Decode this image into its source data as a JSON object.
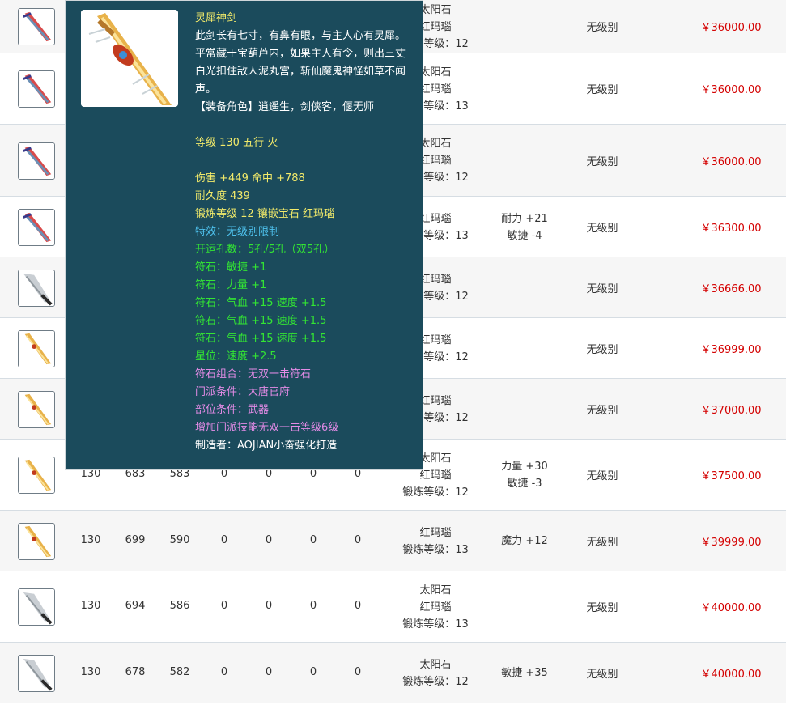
{
  "rows": [
    {
      "level": "",
      "a": "",
      "b": "",
      "z1": "",
      "z2": "",
      "z3": "",
      "z4": "",
      "gem_lines": [
        "太阳石",
        "红玛瑙",
        "锻炼等级：12"
      ],
      "attr_lines": [],
      "category": "无级别",
      "price": "￥36000.00",
      "icon": "red-sword-icon"
    },
    {
      "level": "",
      "a": "",
      "b": "",
      "z1": "",
      "z2": "",
      "z3": "",
      "z4": "",
      "gem_lines": [
        "太阳石",
        "红玛瑙",
        "锻炼等级：13"
      ],
      "attr_lines": [],
      "category": "无级别",
      "price": "￥36000.00",
      "icon": "red-sword-icon"
    },
    {
      "level": "",
      "a": "",
      "b": "",
      "z1": "",
      "z2": "",
      "z3": "",
      "z4": "",
      "gem_lines": [
        "太阳石",
        "红玛瑙",
        "锻炼等级：12"
      ],
      "attr_lines": [],
      "category": "无级别",
      "price": "￥36000.00",
      "icon": "red-sword-icon"
    },
    {
      "level": "",
      "a": "",
      "b": "",
      "z1": "",
      "z2": "",
      "z3": "",
      "z4": "",
      "gem_lines": [
        "红玛瑙",
        "锻炼等级：13"
      ],
      "attr_lines": [
        "耐力 +21",
        "敏捷 -4"
      ],
      "category": "无级别",
      "price": "￥36300.00",
      "icon": "red-sword-icon"
    },
    {
      "level": "",
      "a": "",
      "b": "",
      "z1": "",
      "z2": "",
      "z3": "",
      "z4": "",
      "gem_lines": [
        "红玛瑙",
        "锻炼等级：12"
      ],
      "attr_lines": [],
      "category": "无级别",
      "price": "￥36666.00",
      "icon": "silver-blade-icon"
    },
    {
      "level": "",
      "a": "",
      "b": "",
      "z1": "",
      "z2": "",
      "z3": "",
      "z4": "",
      "gem_lines": [
        "红玛瑙",
        "锻炼等级：12"
      ],
      "attr_lines": [],
      "category": "无级别",
      "price": "￥36999.00",
      "icon": "gold-sword-icon"
    },
    {
      "level": "",
      "a": "",
      "b": "",
      "z1": "",
      "z2": "",
      "z3": "",
      "z4": "",
      "gem_lines": [
        "红玛瑙",
        "锻炼等级：12"
      ],
      "attr_lines": [],
      "category": "无级别",
      "price": "￥37000.00",
      "icon": "gold-sword-icon"
    },
    {
      "level": "130",
      "a": "683",
      "b": "583",
      "z1": "0",
      "z2": "0",
      "z3": "0",
      "z4": "0",
      "gem_lines": [
        "太阳石",
        "红玛瑙",
        "锻炼等级：12"
      ],
      "attr_lines": [
        "力量 +30",
        "敏捷 -3"
      ],
      "category": "无级别",
      "price": "￥37500.00",
      "icon": "gold-sword-icon"
    },
    {
      "level": "130",
      "a": "699",
      "b": "590",
      "z1": "0",
      "z2": "0",
      "z3": "0",
      "z4": "0",
      "gem_lines": [
        "红玛瑙",
        "锻炼等级：13"
      ],
      "attr_lines": [
        "魔力 +12"
      ],
      "category": "无级别",
      "price": "￥39999.00",
      "icon": "gold-sword-icon"
    },
    {
      "level": "130",
      "a": "694",
      "b": "586",
      "z1": "0",
      "z2": "0",
      "z3": "0",
      "z4": "0",
      "gem_lines": [
        "太阳石",
        "红玛瑙",
        "锻炼等级：13"
      ],
      "attr_lines": [],
      "category": "无级别",
      "price": "￥40000.00",
      "icon": "silver-blade-icon"
    },
    {
      "level": "130",
      "a": "678",
      "b": "582",
      "z1": "0",
      "z2": "0",
      "z3": "0",
      "z4": "0",
      "gem_lines": [
        "太阳石",
        "锻炼等级：12"
      ],
      "attr_lines": [
        "敏捷 +35"
      ],
      "category": "无级别",
      "price": "￥40000.00",
      "icon": "silver-blade-icon"
    }
  ],
  "tooltip": {
    "name": "灵犀神剑",
    "description": "此剑长有七寸，有鼻有眼，与主人心有灵犀。平常藏于宝葫芦内，如果主人有令，则出三丈白光扣住敌人泥丸宫，斩仙魔鬼神怪如草不闻声。",
    "roles": "【装备角色】逍遥生，剑侠客，偃无师",
    "level_line": "等级 130 五行 火",
    "damage_line": "伤害 +449 命中 +788",
    "durability_line": "耐久度 439",
    "forge_line": "锻炼等级 12 镶嵌宝石 红玛瑙",
    "effect_line": "特效：无级别限制",
    "holes_line": "开运孔数：5孔/5孔（双5孔）",
    "runes": [
      "符石：敏捷 +1",
      "符石：力量 +1",
      "符石：气血 +15 速度 +1.5",
      "符石：气血 +15 速度 +1.5",
      "符石：气血 +15 速度 +1.5"
    ],
    "star_line": "星位：速度 +2.5",
    "rune_combo": "符石组合：无双一击符石",
    "sect_req": "门派条件：大唐官府",
    "part_req": "部位条件：武器",
    "bonus": "增加门派技能无双一击等级6级",
    "maker": "制造者：AOJIAN小奋强化打造"
  },
  "colors": {
    "price": "#d40000",
    "tooltip_bg": "#1b4b5c",
    "yellow": "#f2ea6a",
    "green": "#33e633",
    "blue": "#4fc3ef",
    "pink": "#e38be6"
  }
}
